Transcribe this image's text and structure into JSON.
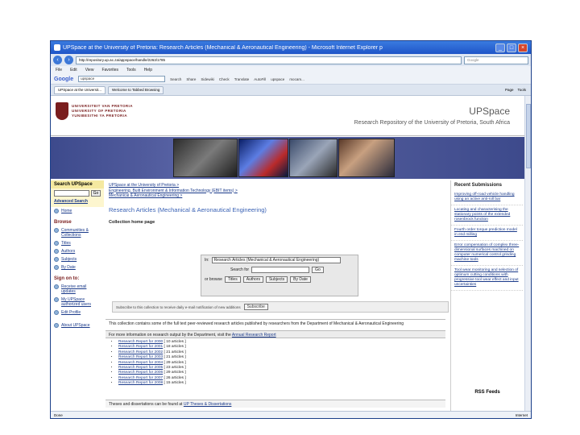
{
  "window": {
    "title": "UPSpace at the University of Pretoria: Research Articles (Mechanical & Aeronautical Engineering) - Microsoft Internet Explorer p"
  },
  "address": {
    "url": "http://repository.up.ac.za/appspace/handle/2263/1785",
    "search_placeholder": "Google"
  },
  "menu": [
    "File",
    "Edit",
    "View",
    "Favorites",
    "Tools",
    "Help"
  ],
  "googlebar": {
    "logo": "Google",
    "query": "upspace",
    "items": [
      "Search",
      "Share",
      "Sidewiki",
      "Check",
      "Translate",
      "AutoFill",
      "upspace",
      "mocam..."
    ]
  },
  "tabs": [
    {
      "label": "UPSpace at the Universit..."
    },
    {
      "label": "Welcome to Tabbed Browsing"
    }
  ],
  "tab_tools": [
    "Page",
    "Tools"
  ],
  "header": {
    "uni_lines": [
      "UNIVERSITEIT VAN PRETORIA",
      "UNIVERSITY OF PRETORIA",
      "YUNIBESITHI YA PRETORIA"
    ],
    "title": "UPSpace",
    "subtitle": "Research Repository of the University of Pretoria, South Africa"
  },
  "leftnav": {
    "search_heading": "Search UPSpace",
    "go_label": "Go",
    "advanced": "Advanced Search",
    "home": "Home",
    "browse_heading": "Browse",
    "browse_items": [
      "Communities & Collections",
      "Titles",
      "Authors",
      "Subjects",
      "By Date"
    ],
    "signon_heading": "Sign on to:",
    "signon_items": [
      "Receive email updates",
      "My UPSpace authorized users",
      "Edit Profile"
    ],
    "about": "About UPSpace"
  },
  "main": {
    "crumbs": [
      "UPSpace at the University of Pretoria >",
      "Engineering, Built Environment & Information Technology (EBIT items) >",
      "Mechanical & Aeronautical Engineering >"
    ],
    "title": "Research Articles (Mechanical & Aeronautical Engineering)",
    "collection_home": "Collection home page",
    "in_label": "In:",
    "scope_value": "Research Articles (Mechanical & Aeronautical Engineering)",
    "search_for_label": "Search for",
    "go": "Go",
    "or_browse": "or browse",
    "browse_buttons": [
      "Titles",
      "Authors",
      "Subjects",
      "By Date"
    ],
    "subscribe_text": "Subscribe to this collection to receive daily e-mail notification of new additions",
    "subscribe_button": "Subscribe",
    "description": "This collection contains some of the full text peer-reviewed research articles published by researchers from the Department of Mechanical & Aeronautical Engineering",
    "more_info_prefix": "For more information on research output by the Department, visit the",
    "more_info_link": "Annual Research Report",
    "reports": [
      {
        "link": "Research Report for 2000",
        "count": "[ 10 articles ]"
      },
      {
        "link": "Research Report for 2001",
        "count": "[ 18 articles ]"
      },
      {
        "link": "Research Report for 2002",
        "count": "[ 21 articles ]"
      },
      {
        "link": "Research Report for 2003",
        "count": "[ 21 articles ]"
      },
      {
        "link": "Research Report for 2004",
        "count": "[ 29 articles ]"
      },
      {
        "link": "Research Report for 2005",
        "count": "[ 23 articles ]"
      },
      {
        "link": "Research Report for 2006",
        "count": "[ 29 articles ]"
      },
      {
        "link": "Research Report for 2007",
        "count": "[ 26 articles ]"
      },
      {
        "link": "Research Report for 2008",
        "count": "[ 15 articles ]"
      }
    ],
    "theses_prefix": "Theses and dissertations can be found at",
    "theses_link": "UP Theses & Dissertations"
  },
  "right": {
    "heading": "Recent Submissions",
    "items": [
      "Improving off-road vehicle handling using an active anti-roll bar",
      "Locating and characterising the stationary points of the extended rosenbrock function",
      "Fourth order torque prediction model in end milling",
      "Error compensation of complex three-dimensional surfaces machined on computer numerical control grinding machine tools",
      "Tool wear monitoring and selection of optimum cutting conditions with progressive tool wear effect and input uncertainties"
    ],
    "rss": "RSS Feeds"
  },
  "status": {
    "left": "Done",
    "zone": "Internet"
  }
}
